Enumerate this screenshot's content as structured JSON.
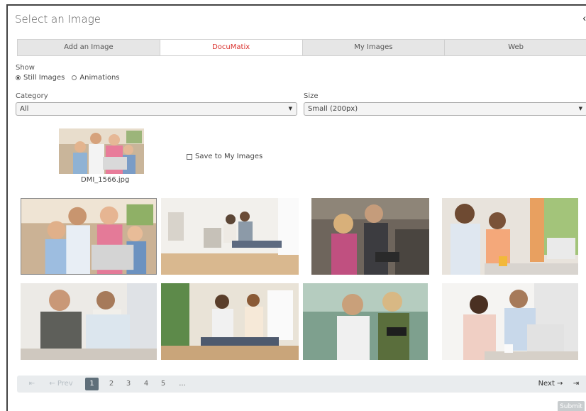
{
  "dialog": {
    "title": "Select an Image",
    "close_icon": "‹"
  },
  "tabs": [
    {
      "label": "Add an Image",
      "active": false
    },
    {
      "label": "DocuMatix",
      "active": true
    },
    {
      "label": "My Images",
      "active": false
    },
    {
      "label": "Web",
      "active": false
    }
  ],
  "show": {
    "label": "Show",
    "options": [
      {
        "label": "Still Images",
        "checked": true
      },
      {
        "label": "Animations",
        "checked": false
      }
    ]
  },
  "category": {
    "label": "Category",
    "value": "All"
  },
  "size": {
    "label": "Size",
    "value": "Small (200px)"
  },
  "preview": {
    "filename": "DMI_1566.jpg"
  },
  "save_option": {
    "label": "Save to My Images",
    "checked": false
  },
  "pagination": {
    "first_icon": "⇤",
    "prev_label": "← Prev",
    "pages": [
      "1",
      "2",
      "3",
      "4",
      "5",
      "..."
    ],
    "active_page": "1",
    "next_label": "Next →",
    "last_icon": "⇥"
  },
  "submit_label": "Submit",
  "colors": {
    "accent": "#d9302c",
    "pager_active": "#5f6f7a"
  }
}
